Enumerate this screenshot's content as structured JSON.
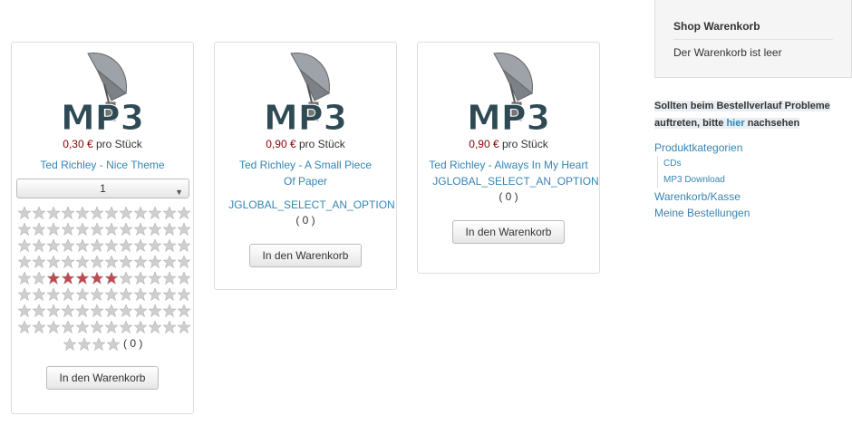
{
  "products": [
    {
      "price": "0,30 €",
      "unit": "pro Stück",
      "title": "Ted Richley - Nice Theme",
      "select_value": "1",
      "votes": "( 0 )",
      "cart_button": "In den Warenkorb",
      "rating": 5
    },
    {
      "price": "0,90 €",
      "unit": "pro Stück",
      "title": "Ted Richley - A Small Piece Of Paper",
      "option": "JGLOBAL_SELECT_AN_OPTION",
      "votes": "( 0 )",
      "cart_button": "In den Warenkorb"
    },
    {
      "price": "0,90 €",
      "unit": "pro Stück",
      "title": "Ted Richley - Always In My Heart",
      "option": "JGLOBAL_SELECT_AN_OPTION",
      "votes": "( 0 )",
      "cart_button": "In den Warenkorb"
    }
  ],
  "product_image_text": "MP3",
  "cart": {
    "title": "Shop Warenkorb",
    "empty_text": "Der Warenkorb ist leer"
  },
  "notice": {
    "line1": "Sollten beim Bestellverlauf Probleme",
    "line2_pre": "auftreten, bitte ",
    "link": "hier",
    "line2_post": " nachsehen"
  },
  "nav": {
    "categories": "Produktkategorien",
    "sub": [
      "CDs",
      "MP3 Download"
    ],
    "checkout": "Warenkorb/Kasse",
    "orders": "Meine Bestellungen"
  },
  "colors": {
    "price": "#8b0000",
    "link": "#3585b4",
    "star_active": "#c0494f",
    "star_inactive": "#cfcfcf"
  }
}
